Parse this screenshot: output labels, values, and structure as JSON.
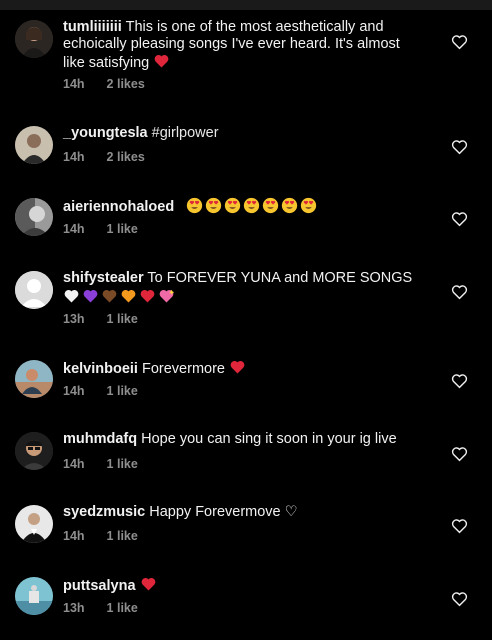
{
  "comments": [
    {
      "username": "tumliiiiiii",
      "text": "This is one of the most aesthetically and echoically pleasing songs I've ever heard. It's almost like satisfying",
      "emoji": [
        "red-heart"
      ],
      "time": "14h",
      "likes": "2 likes"
    },
    {
      "username": "_youngtesla",
      "text": "#girlpower",
      "emoji": [],
      "time": "14h",
      "likes": "2 likes"
    },
    {
      "username": "aieriennohaloed",
      "text": "",
      "emoji": [
        "heart-eyes",
        "heart-eyes",
        "heart-eyes",
        "heart-eyes",
        "heart-eyes",
        "heart-eyes",
        "heart-eyes"
      ],
      "time": "14h",
      "likes": "1 like"
    },
    {
      "username": "shifystealer",
      "text": "To FOREVER YUNA and MORE SONGS",
      "emoji": [
        "white-heart",
        "purple-heart",
        "brown-heart",
        "orange-heart",
        "red-heart",
        "sparkling-heart"
      ],
      "time": "13h",
      "likes": "1 like"
    },
    {
      "username": "kelvinboeii",
      "text": "Forevermore",
      "emoji": [
        "red-heart"
      ],
      "time": "14h",
      "likes": "1 like"
    },
    {
      "username": "muhmdafq",
      "text": "Hope you can sing it soon in your ig live",
      "emoji": [],
      "time": "14h",
      "likes": "1 like"
    },
    {
      "username": "syedzmusic",
      "text": "Happy Forevermove ♡",
      "emoji": [],
      "time": "14h",
      "likes": "1 like"
    },
    {
      "username": "puttsalyna",
      "text": "",
      "emoji": [
        "red-heart"
      ],
      "time": "13h",
      "likes": "1 like"
    }
  ],
  "icons": {
    "like_button": "heart-outline-icon"
  },
  "colors": {
    "background": "#000000",
    "meta": "#8e8e8e",
    "heart_red": "#e0263a"
  }
}
